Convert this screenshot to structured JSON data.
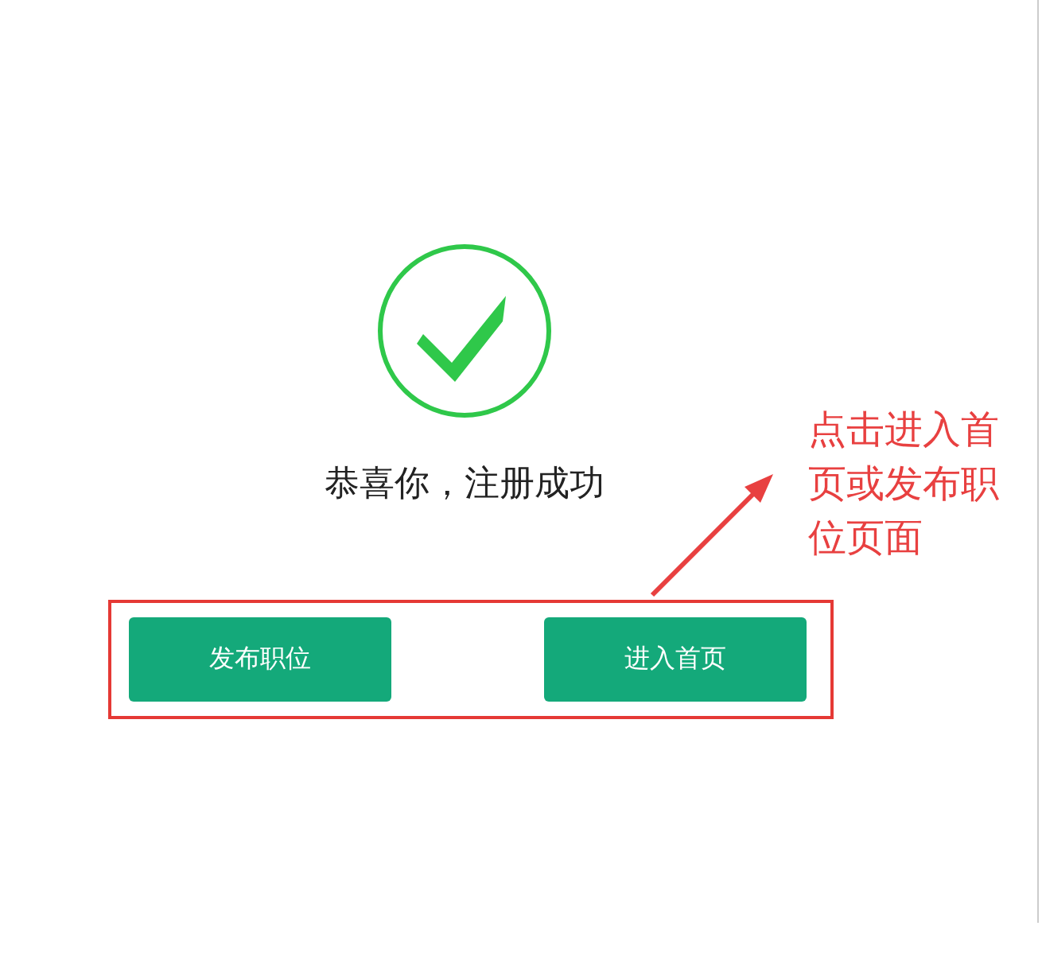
{
  "message": "恭喜你，注册成功",
  "buttons": [
    {
      "label": "发布职位"
    },
    {
      "label": "进入首页"
    }
  ],
  "annotation": {
    "text": "点击进入首页或发布职位页面"
  }
}
